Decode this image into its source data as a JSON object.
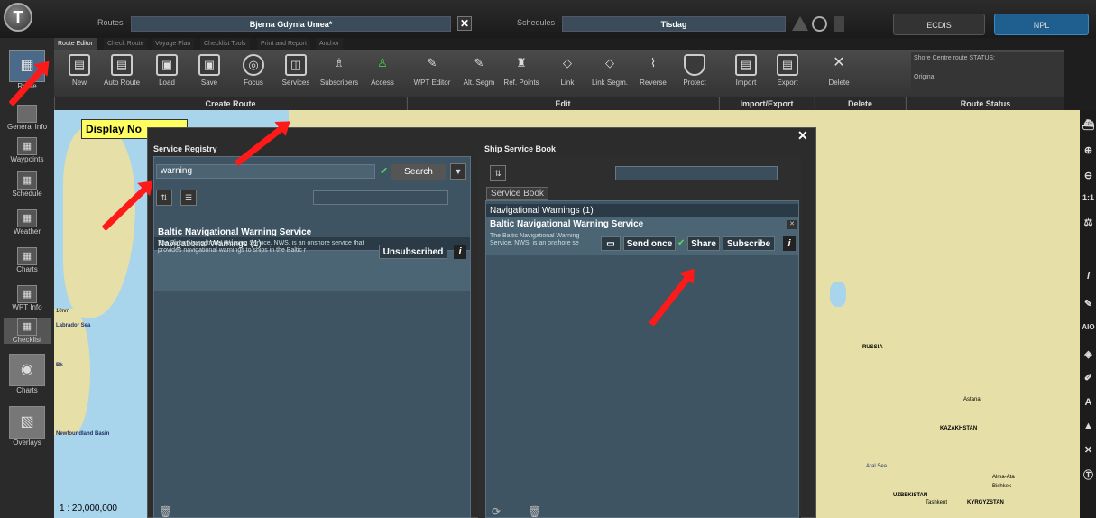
{
  "app": {
    "logo_letter": "T"
  },
  "topbar": {
    "routes_label": "Routes",
    "route_value": "Bjerna Gdynia Umea*",
    "schedules_label": "Schedules",
    "schedule_value": "Tisdag",
    "ecdis_label": "ECDIS",
    "npl_label": "NPL"
  },
  "tabs": [
    "Route Editor",
    "Check Route",
    "Voyage Plan",
    "Checklist Tools",
    "Print and Report",
    "Anchor"
  ],
  "ribbon": {
    "buttons": [
      "New",
      "Auto Route",
      "Load",
      "Save",
      "Focus",
      "Services",
      "Subscribers",
      "Access",
      "WPT Editor",
      "Alt. Segm",
      "Ref. Points",
      "Link",
      "Link Segm.",
      "Reverse",
      "Protect",
      "Import",
      "Export",
      "Delete"
    ],
    "sections": [
      "Create Route",
      "Edit",
      "Import/Export",
      "Delete",
      "Route Status"
    ],
    "status_title": "Shore Centre route STATUS:",
    "status_value": "Original"
  },
  "sidebar": {
    "route_label": "Route",
    "items": [
      "General Info",
      "Waypoints",
      "Schedule",
      "Weather",
      "Charts",
      "WPT Info",
      "Checklist",
      "Charts",
      "Overlays"
    ]
  },
  "map": {
    "display_label": "Display No",
    "scale": "1 : 20,000,000",
    "scale_bar": "10nm",
    "labels": [
      "Labrador Sea",
      "Newfoundland Basin",
      "RUSSIA",
      "Astana",
      "KAZAKHSTAN",
      "Aral Sea",
      "UZBEKISTAN",
      "Tashkent",
      "KYRGYZSTAN",
      "Bishkek",
      "Alma-Ata",
      "Bk"
    ]
  },
  "registry": {
    "title": "Service Registry",
    "search_value": "warning",
    "search_button": "Search",
    "category": "Navigational Warnings (1)",
    "service_title": "Baltic Navigational Warning Service",
    "service_desc": "The Baltic Navigational Warning Service, NWS, is an onshore service that provides navigational warnings to ships in the Baltic r",
    "unsubscribed": "Unsubscribed",
    "info": "i"
  },
  "shipbook": {
    "title": "Ship Service Book",
    "tab": "Service Book",
    "category": "Navigational Warnings (1)",
    "service_title": "Baltic Navigational Warning Service",
    "service_desc": "The Baltic Navigational Warning Service, NWS, is an onshore se",
    "send_once": "Send once",
    "share": "Share",
    "subscribe": "Subscribe",
    "info": "i"
  },
  "rightbar": {
    "icons": [
      "ship-icon",
      "zoom-in-icon",
      "zoom-out-icon",
      "one-to-one-icon",
      "scale-icon",
      "info-icon",
      "measure-icon",
      "aio-icon",
      "layers-icon"
    ],
    "one_to_one": "1:1",
    "aio": "AIO"
  },
  "colors": {
    "land": "#e6dfa8",
    "water": "#a8d4ec",
    "panel": "#3f5463",
    "arrow": "#ff1a1a",
    "npl": "#1f5f8f"
  }
}
